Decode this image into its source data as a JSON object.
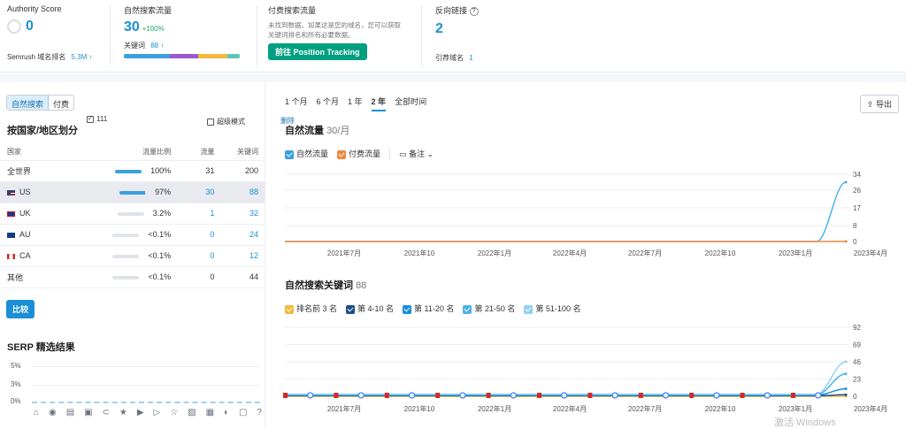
{
  "authority": {
    "label": "Authority Score",
    "value": "0",
    "rank_label": "Semrush 域名排名",
    "rank_value": "5.3M",
    "rank_arrow": "↑"
  },
  "organic": {
    "label": "自然搜索流量",
    "value": "30",
    "change": "+100%",
    "kw_label": "关键词",
    "kw_value": "88",
    "kw_arrow": "↑"
  },
  "paid": {
    "label": "付费搜索流量",
    "note_line1": "未找到数据。如果这是您的域名，您可以获取",
    "note_line2": "关键词排名和所有必要数据。",
    "button": "前往 Position Tracking"
  },
  "backlinks": {
    "label": "反向链接",
    "value": "2",
    "ref_label": "引荐域名",
    "ref_value": "1"
  },
  "left": {
    "seg_organic": "自然搜索",
    "seg_paid": "付费",
    "checkbox_label": "111",
    "geo_title": "按国家/地区划分",
    "super_mode": "超级模式",
    "headers": {
      "country": "国家",
      "share": "流量比例",
      "traffic": "流量",
      "keywords": "关键词"
    },
    "rows": [
      {
        "country": "全世界",
        "share": "100%",
        "traffic": "31",
        "keywords": "200",
        "bar": 1
      },
      {
        "country": "US",
        "share": "97%",
        "traffic": "30",
        "keywords": "88",
        "bar": 0.97
      },
      {
        "country": "UK",
        "share": "3.2%",
        "traffic": "1",
        "keywords": "32",
        "bar": 0.03
      },
      {
        "country": "AU",
        "share": "<0.1%",
        "traffic": "0",
        "keywords": "24",
        "bar": 0
      },
      {
        "country": "CA",
        "share": "<0.1%",
        "traffic": "0",
        "keywords": "12",
        "bar": 0
      },
      {
        "country": "其他",
        "share": "<0.1%",
        "traffic": "0",
        "keywords": "44",
        "bar": 0
      }
    ],
    "compare_button": "比较",
    "serp_title": "SERP 精选结果",
    "serp_ticks": [
      "5%",
      "3%",
      "0%"
    ]
  },
  "right": {
    "tabs": [
      "1 个月",
      "6 个月",
      "1 年",
      "2 年",
      "全部时间"
    ],
    "active_tab": "2 年",
    "export": "导出",
    "top_badge": "删除",
    "traffic_title": "自然流量",
    "traffic_sub": "30/月",
    "legend1": [
      "自然流量",
      "付费流量"
    ],
    "notes": "备注",
    "kw_title": "自然搜索关键词",
    "kw_count": "88",
    "legend2": [
      "排名前 3 名",
      "第 4-10 名",
      "第 11-20 名",
      "第 21-50 名",
      "第 51-100 名"
    ],
    "watermark": "激活 Windows"
  },
  "colors": {
    "accent": "#1a8fd6",
    "green": "#009f81",
    "orange": "#f08a3c",
    "yellow": "#f2b93b",
    "navy": "#1d4e89"
  },
  "chart_data": [
    {
      "type": "line",
      "title": "自然流量",
      "x": [
        "2021年7月",
        "2021年10",
        "2022年1月",
        "2022年4月",
        "2022年7月",
        "2022年10",
        "2023年1月",
        "2023年4月"
      ],
      "series": [
        {
          "name": "自然流量",
          "values": [
            0,
            0,
            0,
            0,
            0,
            0,
            0,
            30
          ]
        },
        {
          "name": "付费流量",
          "values": [
            0,
            0,
            0,
            0,
            0,
            0,
            0,
            0
          ]
        }
      ],
      "yticks": [
        0,
        8,
        17,
        26,
        34
      ],
      "ylim": [
        0,
        34
      ]
    },
    {
      "type": "area",
      "title": "自然搜索关键词",
      "x": [
        "2021年7月",
        "2021年10",
        "2022年1月",
        "2022年4月",
        "2022年7月",
        "2022年10",
        "2023年1月",
        "2023年4月"
      ],
      "series": [
        {
          "name": "排名前 3 名",
          "values": [
            0,
            0,
            0,
            0,
            0,
            0,
            0,
            0
          ]
        },
        {
          "name": "第 4-10 名",
          "values": [
            0,
            0,
            0,
            0,
            0,
            0,
            0,
            2
          ]
        },
        {
          "name": "第 11-20 名",
          "values": [
            0,
            0,
            0,
            0,
            0,
            0,
            0,
            10
          ]
        },
        {
          "name": "第 21-50 名",
          "values": [
            0,
            0,
            0,
            0,
            0,
            0,
            0,
            30
          ]
        },
        {
          "name": "第 51-100 名",
          "values": [
            0,
            0,
            0,
            0,
            0,
            0,
            0,
            46
          ]
        }
      ],
      "yticks": [
        0,
        23,
        46,
        69,
        92
      ],
      "ylim": [
        0,
        92
      ]
    }
  ]
}
